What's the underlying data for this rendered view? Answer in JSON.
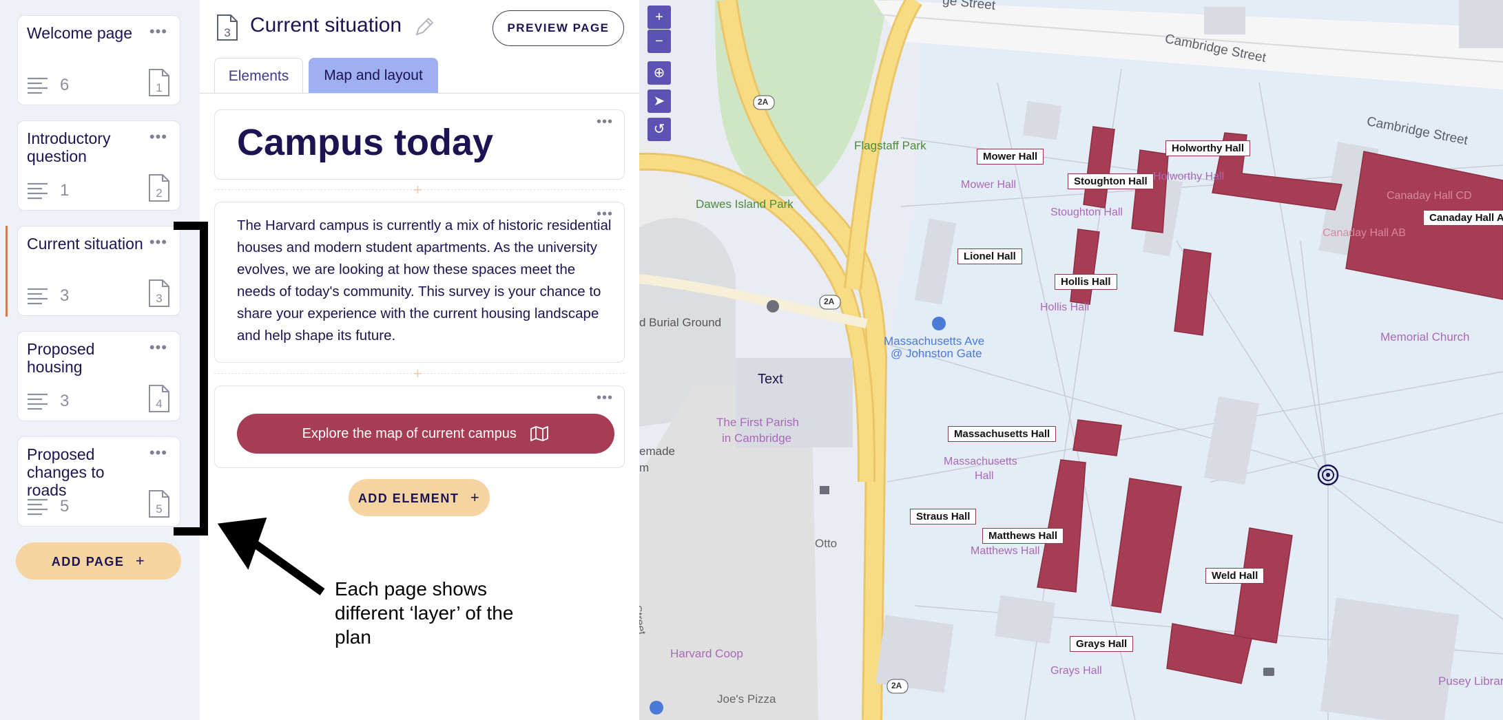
{
  "sidebar": {
    "pages": [
      {
        "title": "Welcome page",
        "count": "6",
        "number": "1"
      },
      {
        "title": "Introductory question",
        "count": "1",
        "number": "2"
      },
      {
        "title": "Current situation",
        "count": "3",
        "number": "3"
      },
      {
        "title": "Proposed housing",
        "count": "3",
        "number": "4"
      },
      {
        "title": "Proposed changes to roads",
        "count": "5",
        "number": "5"
      }
    ],
    "active_index": 2,
    "add_page_label": "ADD PAGE"
  },
  "editor": {
    "page_number": "3",
    "page_title": "Current situation",
    "preview_label": "PREVIEW PAGE",
    "tabs": [
      {
        "label": "Elements",
        "active": true
      },
      {
        "label": "Map and layout",
        "active": false
      }
    ],
    "heading": "Campus today",
    "body": "The Harvard campus is currently a mix of historic residential houses and modern student apartments. As the university evolves, we are looking at how these spaces meet the needs of today's community. This survey is your chance to share your experience with the current housing landscape and help shape its future.",
    "explore_label": "Explore the map of current campus",
    "add_element_label": "ADD ELEMENT"
  },
  "annotation": {
    "text": "Each page shows different ‘layer’ of the plan"
  },
  "map": {
    "controls": [
      "zoom-in",
      "zoom-out",
      "zoom-to-area",
      "locate",
      "reset"
    ],
    "hall_labels": [
      "Mower Hall",
      "Holworthy Hall",
      "Stoughton Hall",
      "Canaday Hall A",
      "Lionel Hall",
      "Hollis Hall",
      "Massachusetts Hall",
      "Straus Hall",
      "Matthews Hall",
      "Weld Hall",
      "Grays Hall"
    ],
    "base_labels": {
      "cambridge_st_1": "Cambridge Street",
      "cambridge_st_2": "Cambridge Street",
      "street_top": "ge Street",
      "flagstaff": "Flagstaff Park",
      "dawes": "Dawes Island Park",
      "burial": "d Burial Ground",
      "mass_ave": "Massachusetts Ave",
      "johnston": "@ Johnston Gate",
      "text_label": "Text",
      "first_parish_1": "The First Parish",
      "first_parish_2": "in Cambridge",
      "emade": "emade",
      "m": "m",
      "otto": "Otto",
      "harvard_coop": "Harvard Coop",
      "joes_pizza": "Joe's Pizza",
      "memorial_church": "Memorial Church",
      "pusey": "Pusey Library",
      "canaday_cd": "Canaday Hall CD",
      "canaday_ab": "Canaday Hall AB",
      "mower_base": "Mower Hall",
      "holworthy_base": "Holworthy Hall",
      "stoughton_base": "Stoughton Hall",
      "hollis_base": "Hollis Hall",
      "mass_base_1": "Massachusetts",
      "mass_base_2": "Hall",
      "matthews_base": "Matthews Hall",
      "grays_base": "Grays Hall",
      "street_left": "Street",
      "route_2a": "2A"
    },
    "colors": {
      "building": "#a73d55",
      "roads": "#f7d67a",
      "park": "#cfe6c4",
      "water": "#e4ecf6"
    }
  }
}
